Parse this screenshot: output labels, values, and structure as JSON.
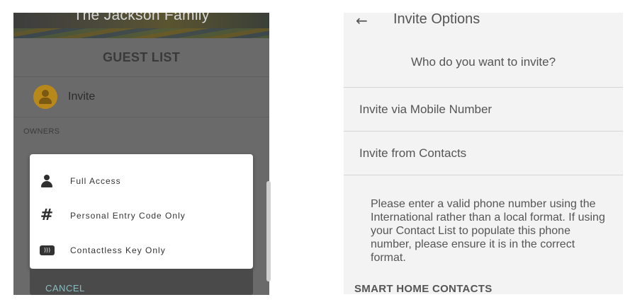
{
  "left_panel": {
    "hero_title": "The Jackson Family",
    "header": "GUEST LIST",
    "invite_label": "Invite",
    "owners_label": "OWNERS",
    "popup": {
      "items": [
        {
          "label": "Full Access",
          "icon": "person-icon"
        },
        {
          "label": "Personal Entry Code Only",
          "icon": "hash-icon"
        },
        {
          "label": "Contactless Key Only",
          "icon": "contactless-key-icon"
        }
      ],
      "cancel_label": "CANCEL"
    },
    "colors": {
      "overlay": "#6a6a6a",
      "avatar": "#b9881a",
      "cancel_text": "#8bbcc0"
    }
  },
  "right_panel": {
    "title": "Invite Options",
    "question": "Who do you want to invite?",
    "options": [
      {
        "label": "Invite via Mobile Number"
      },
      {
        "label": "Invite from Contacts"
      }
    ],
    "note": "Please enter a valid phone number using the International rather than a local format. If using your Contact List to populate this phone number, please ensure it is in the correct format.",
    "section_title": "SMART HOME CONTACTS",
    "colors": {
      "background": "#f3f3f3",
      "text": "#555555"
    }
  }
}
